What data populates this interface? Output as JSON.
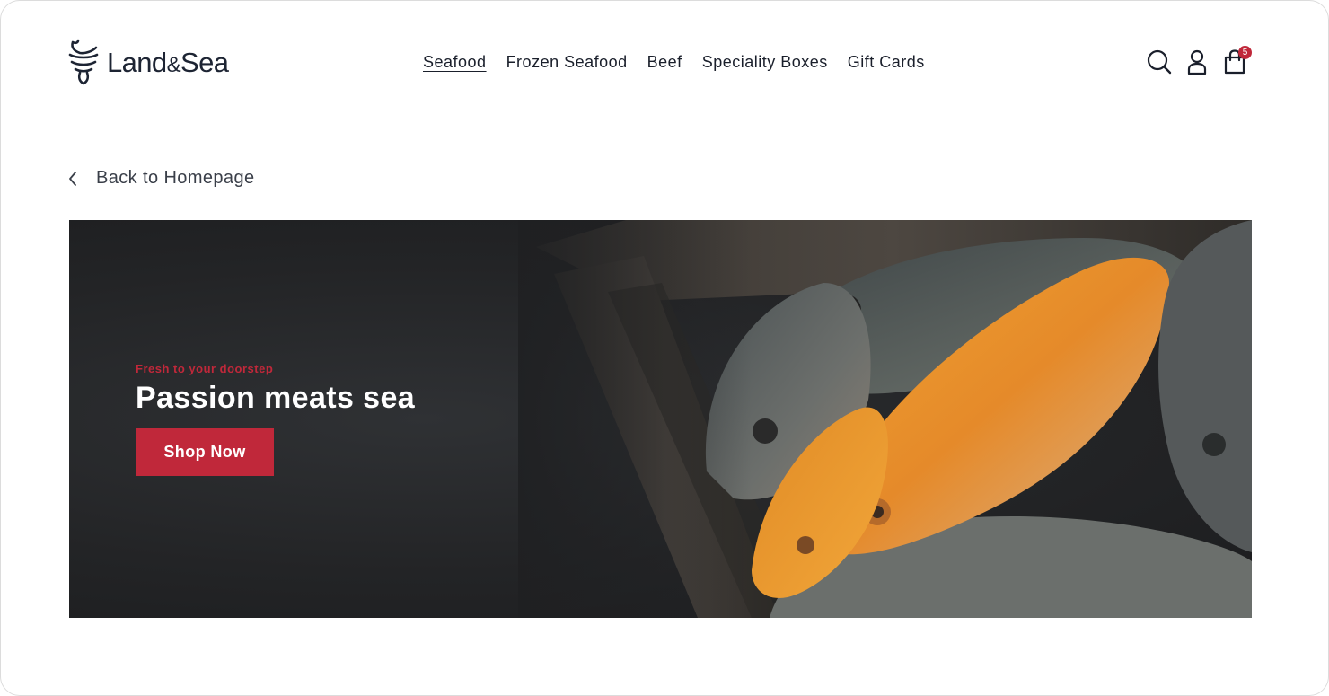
{
  "brand": {
    "name_part1": "Land",
    "name_amp": "&",
    "name_part2": "Sea",
    "logo_icon": "fish-tail-icon"
  },
  "nav": {
    "items": [
      {
        "label": "Seafood",
        "active": true
      },
      {
        "label": "Frozen Seafood",
        "active": false
      },
      {
        "label": "Beef",
        "active": false
      },
      {
        "label": "Speciality Boxes",
        "active": false
      },
      {
        "label": "Gift Cards",
        "active": false
      }
    ]
  },
  "header_icons": {
    "search": "search-icon",
    "account": "user-icon",
    "cart": "shopping-bag-icon",
    "cart_count": "5"
  },
  "back_link": {
    "label": "Back to Homepage",
    "icon": "chevron-left-icon"
  },
  "hero": {
    "eyebrow": "Fresh to your doorstep",
    "headline": "Passion meats sea",
    "cta_label": "Shop Now",
    "image_description_icon": "fish-photo"
  },
  "colors": {
    "accent": "#c0283a",
    "text": "#1a1f2b",
    "hero_bg": "#232426"
  }
}
